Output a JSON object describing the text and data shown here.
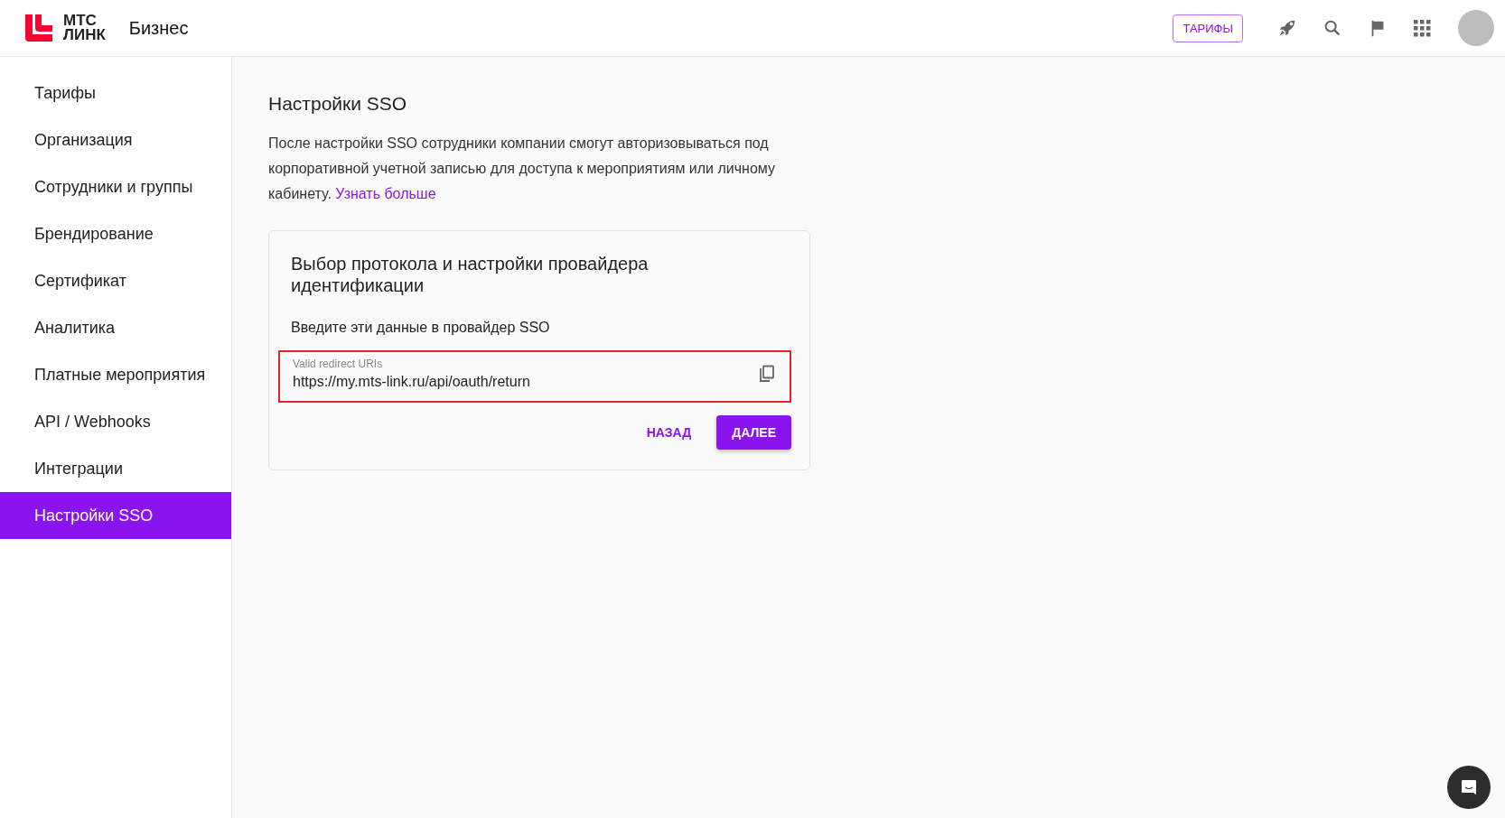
{
  "header": {
    "logo_line1": "МТС",
    "logo_line2": "ЛИНК",
    "product": "Бизнес",
    "tariffs_button": "ТАРИФЫ"
  },
  "sidebar": {
    "items": [
      {
        "label": "Тарифы",
        "selected": false
      },
      {
        "label": "Организация",
        "selected": false
      },
      {
        "label": "Сотрудники и группы",
        "selected": false
      },
      {
        "label": "Брендирование",
        "selected": false
      },
      {
        "label": "Сертификат",
        "selected": false
      },
      {
        "label": "Аналитика",
        "selected": false
      },
      {
        "label": "Платные мероприятия",
        "selected": false
      },
      {
        "label": "API / Webhooks",
        "selected": false
      },
      {
        "label": "Интеграции",
        "selected": false
      },
      {
        "label": "Настройки SSO",
        "selected": true
      }
    ]
  },
  "page": {
    "title": "Настройки SSO",
    "description": "После настройки SSO сотрудники компании смогут авторизовываться под корпоративной учетной записью для доступа к мероприятиям или личному кабинету.",
    "learn_more_link": "Узнать больше"
  },
  "card": {
    "title": "Выбор протокола и настройки провайдера идентификации",
    "instruction": "Введите эти данные в провайдер SSO",
    "field": {
      "label": "Valid redirect URIs",
      "value": "https://my.mts-link.ru/api/oauth/return",
      "highlighted": true
    },
    "back_button": "НАЗАД",
    "next_button": "ДАЛЕЕ"
  }
}
